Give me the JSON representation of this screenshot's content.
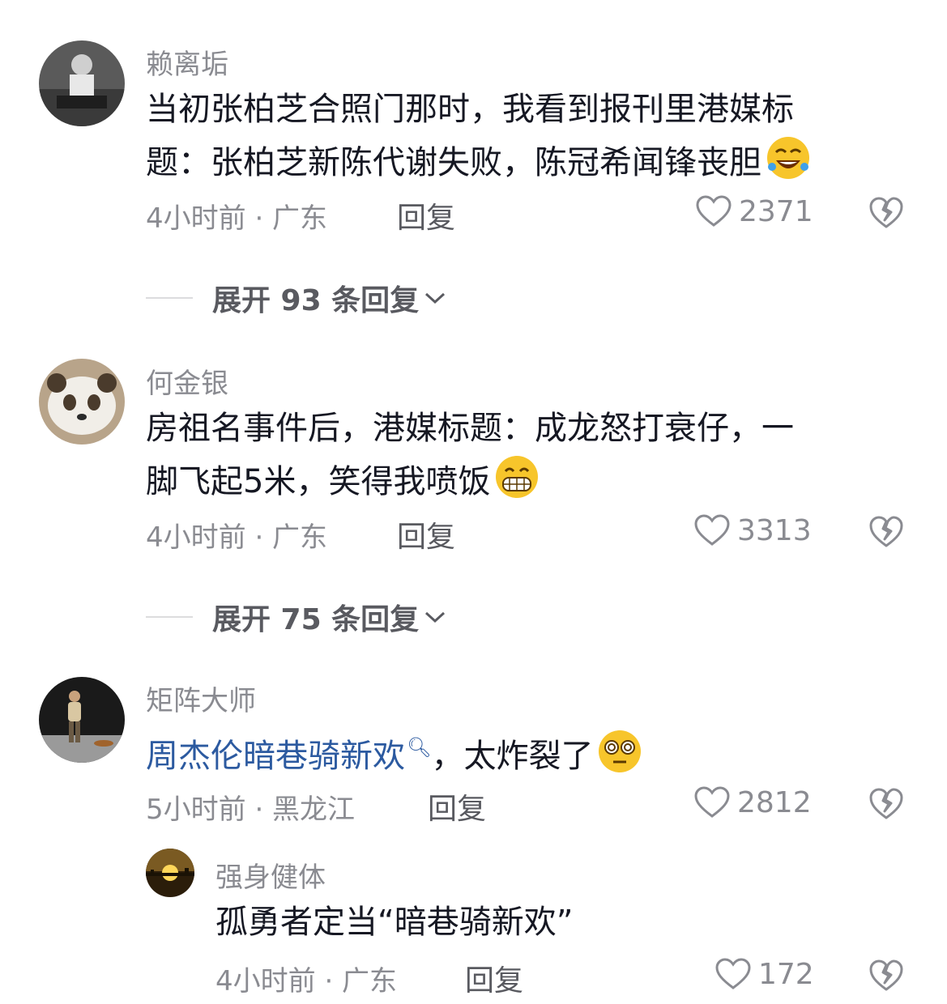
{
  "comments": [
    {
      "username": "赖离垢",
      "lines": [
        "当初张柏芝合照门那时，我看到报刊里港媒标",
        "题：张柏芝新陈代谢失败，陈冠希闻锋丧胆"
      ],
      "emoji": "rolling-on-floor-laughing-emoji",
      "meta": "4小时前 · 广东",
      "reply_label": "回复",
      "likes": "2371",
      "expand_label": "展开 93 条回复"
    },
    {
      "username": "何金银",
      "lines": [
        "房祖名事件后，港媒标题：成龙怒打衰仔，一",
        "脚飞起5米，笑得我喷饭"
      ],
      "emoji": "grinning-emoji",
      "meta": "4小时前 · 广东",
      "reply_label": "回复",
      "likes": "3313",
      "expand_label": "展开 75 条回复"
    },
    {
      "username": "矩阵大师",
      "link_text": "周杰伦暗巷骑新欢",
      "after_link": "，太炸裂了",
      "emoji": "dizzy-eyes-emoji",
      "meta": "5小时前 · 黑龙江",
      "reply_label": "回复",
      "likes": "2812"
    },
    {
      "username": "强身健体",
      "text": "孤勇者定当“暗巷骑新欢”",
      "meta": "4小时前 · 广东",
      "reply_label": "回复",
      "likes": "172"
    }
  ],
  "colors": {
    "username": "#8a8b91",
    "body": "#161823",
    "link": "#2c5aa0",
    "meta": "#8a8b91"
  },
  "icons": [
    "heart-outline-icon",
    "broken-heart-icon",
    "chevron-down-icon",
    "search-icon"
  ]
}
